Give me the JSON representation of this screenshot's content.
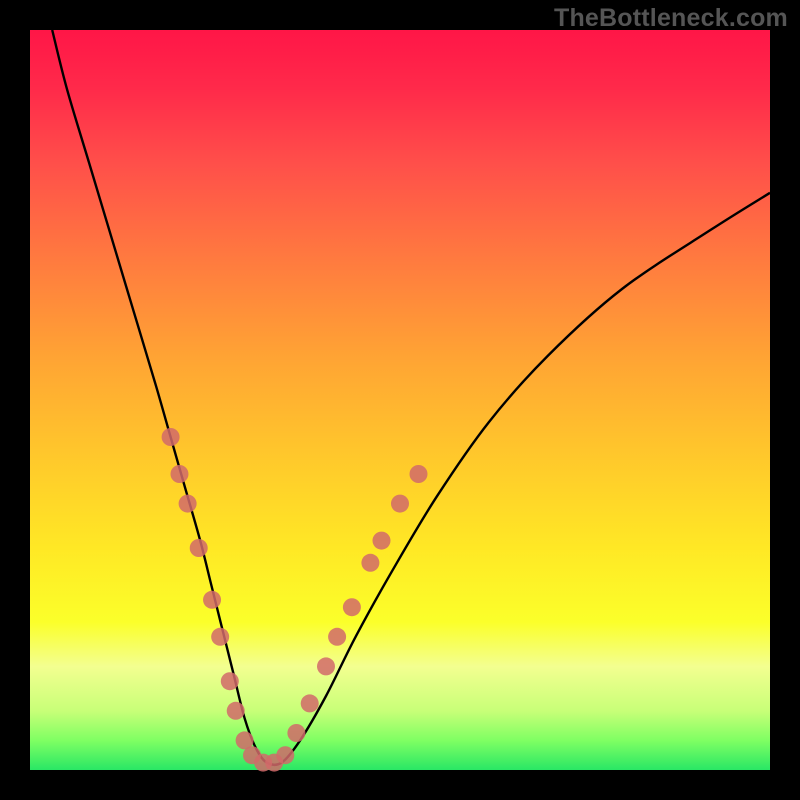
{
  "watermark": "TheBottleneck.com",
  "chart_data": {
    "type": "line",
    "title": "",
    "xlabel": "",
    "ylabel": "",
    "xlim": [
      0,
      100
    ],
    "ylim": [
      0,
      100
    ],
    "grid": false,
    "series": [
      {
        "name": "bottleneck-curve",
        "color": "#000000",
        "x": [
          3,
          5,
          8,
          11,
          14,
          17,
          19,
          21,
          23,
          24.5,
          26,
          27.5,
          29,
          30.5,
          32,
          34,
          36.5,
          40,
          44,
          49,
          55,
          62,
          70,
          80,
          92,
          100
        ],
        "y": [
          100,
          92,
          82,
          72,
          62,
          52,
          45,
          38,
          31,
          25,
          19,
          13,
          7,
          3,
          1,
          1,
          4,
          10,
          18,
          27,
          37,
          47,
          56,
          65,
          73,
          78
        ]
      }
    ],
    "markers": {
      "name": "highlight-beads",
      "color": "#d16a6a",
      "radius_px": 9,
      "points": [
        {
          "x": 19.0,
          "y": 45
        },
        {
          "x": 20.2,
          "y": 40
        },
        {
          "x": 21.3,
          "y": 36
        },
        {
          "x": 22.8,
          "y": 30
        },
        {
          "x": 24.6,
          "y": 23
        },
        {
          "x": 25.7,
          "y": 18
        },
        {
          "x": 27.0,
          "y": 12
        },
        {
          "x": 27.8,
          "y": 8
        },
        {
          "x": 29.0,
          "y": 4
        },
        {
          "x": 30.0,
          "y": 2
        },
        {
          "x": 31.5,
          "y": 1
        },
        {
          "x": 33.0,
          "y": 1
        },
        {
          "x": 34.5,
          "y": 2
        },
        {
          "x": 36.0,
          "y": 5
        },
        {
          "x": 37.8,
          "y": 9
        },
        {
          "x": 40.0,
          "y": 14
        },
        {
          "x": 41.5,
          "y": 18
        },
        {
          "x": 43.5,
          "y": 22
        },
        {
          "x": 46.0,
          "y": 28
        },
        {
          "x": 47.5,
          "y": 31
        },
        {
          "x": 50.0,
          "y": 36
        },
        {
          "x": 52.5,
          "y": 40
        }
      ]
    }
  }
}
